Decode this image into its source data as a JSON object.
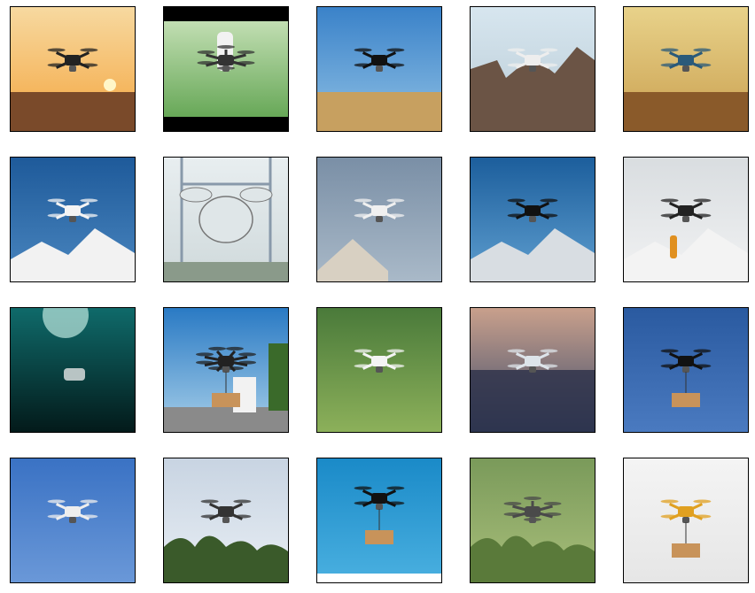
{
  "grid": {
    "rows": 4,
    "columns": 5,
    "tile_border_color": "#000000",
    "background_color": "#ffffff"
  },
  "tiles": [
    {
      "scene": "sunset-field",
      "drone": "quadcopter",
      "sky": [
        "#f7d9a0",
        "#f4a640"
      ],
      "ground": "#7a4a2a",
      "drone_color": "#222222"
    },
    {
      "scene": "robot-rider",
      "drone": "hexacopter",
      "sky": [
        "#cfe6c0",
        "#5aa04a"
      ],
      "ground": "#000000",
      "drone_color": "#333333"
    },
    {
      "scene": "blue-sky-field",
      "drone": "quadcopter",
      "sky": [
        "#3a82c9",
        "#8fc0e4"
      ],
      "ground": "#c7a060",
      "drone_color": "#111111"
    },
    {
      "scene": "ruins",
      "drone": "quadcopter",
      "sky": [
        "#d7e6ef",
        "#b9cbd6"
      ],
      "ground": "#6b5445",
      "drone_color": "#eeeeee"
    },
    {
      "scene": "sunset-wheat",
      "drone": "quadcopter",
      "sky": [
        "#e8d28a",
        "#caa050"
      ],
      "ground": "#8a5a2a",
      "drone_color": "#2a5a7a"
    },
    {
      "scene": "mountain-blue",
      "drone": "quadcopter",
      "sky": [
        "#1e5a9a",
        "#4a86bf"
      ],
      "ground": "#f2f2f2",
      "drone_color": "#f4f4f4"
    },
    {
      "scene": "tower",
      "drone": "passenger-drone",
      "sky": [
        "#e8eef0",
        "#cfd9db"
      ],
      "ground": "#8a9a8a",
      "drone_color": "#dfe6e8"
    },
    {
      "scene": "house-roof",
      "drone": "quadcopter",
      "sky": [
        "#7a8fa6",
        "#a9b9c8"
      ],
      "ground": "#d8d0c2",
      "drone_color": "#f0f0f0"
    },
    {
      "scene": "snow-peak-blue",
      "drone": "quadcopter",
      "sky": [
        "#1c5e9c",
        "#5f9fd0"
      ],
      "ground": "#d8dde2",
      "drone_color": "#111111"
    },
    {
      "scene": "snow-hiker",
      "drone": "quadcopter",
      "sky": [
        "#d9dde0",
        "#f1f2f3"
      ],
      "ground": "#f3f3f3",
      "drone_color": "#222222"
    },
    {
      "scene": "underwater",
      "drone": "underwater-drone",
      "sky": [
        "#0f6a6a",
        "#031a1a"
      ],
      "ground": "#021010",
      "drone_color": "#b8c4c4"
    },
    {
      "scene": "delivery-street",
      "drone": "octocopter",
      "sky": [
        "#2a7ac4",
        "#a7cfe9"
      ],
      "ground": "#8a8a8a",
      "drone_color": "#222222"
    },
    {
      "scene": "green-bokeh",
      "drone": "quadcopter",
      "sky": [
        "#4a7a3a",
        "#8cb05a"
      ],
      "ground": "#3a6a2a",
      "drone_color": "#f4f4f4"
    },
    {
      "scene": "dusk-blur",
      "drone": "quadcopter",
      "sky": [
        "#c9a08c",
        "#3a4a6a"
      ],
      "ground": "#2a3048",
      "drone_color": "#dde4ea"
    },
    {
      "scene": "blue-cargo",
      "drone": "quadcopter",
      "sky": [
        "#2a5aa0",
        "#4a7ac0"
      ],
      "ground": "#2a5aa0",
      "drone_color": "#111111"
    },
    {
      "scene": "blue-sky-low",
      "drone": "quadcopter",
      "sky": [
        "#3a72c4",
        "#6a98d8"
      ],
      "ground": "#3a72c4",
      "drone_color": "#eeeeee"
    },
    {
      "scene": "treetops",
      "drone": "quadcopter",
      "sky": [
        "#c8d4e2",
        "#e8eef4"
      ],
      "ground": "#3a5a2a",
      "drone_color": "#333333"
    },
    {
      "scene": "parcel-blue",
      "drone": "quadcopter",
      "sky": [
        "#1a8ac8",
        "#4ab0e0"
      ],
      "ground": "#1a8ac8",
      "drone_color": "#111111"
    },
    {
      "scene": "forest-blur",
      "drone": "hexacopter",
      "sky": [
        "#7a9a5a",
        "#a8be7a"
      ],
      "ground": "#5a7a3a",
      "drone_color": "#4a4a4a"
    },
    {
      "scene": "white-studio",
      "drone": "quadcopter",
      "sky": [
        "#f4f4f4",
        "#e6e6e6"
      ],
      "ground": "#e6e6e6",
      "drone_color": "#e0a020"
    }
  ]
}
